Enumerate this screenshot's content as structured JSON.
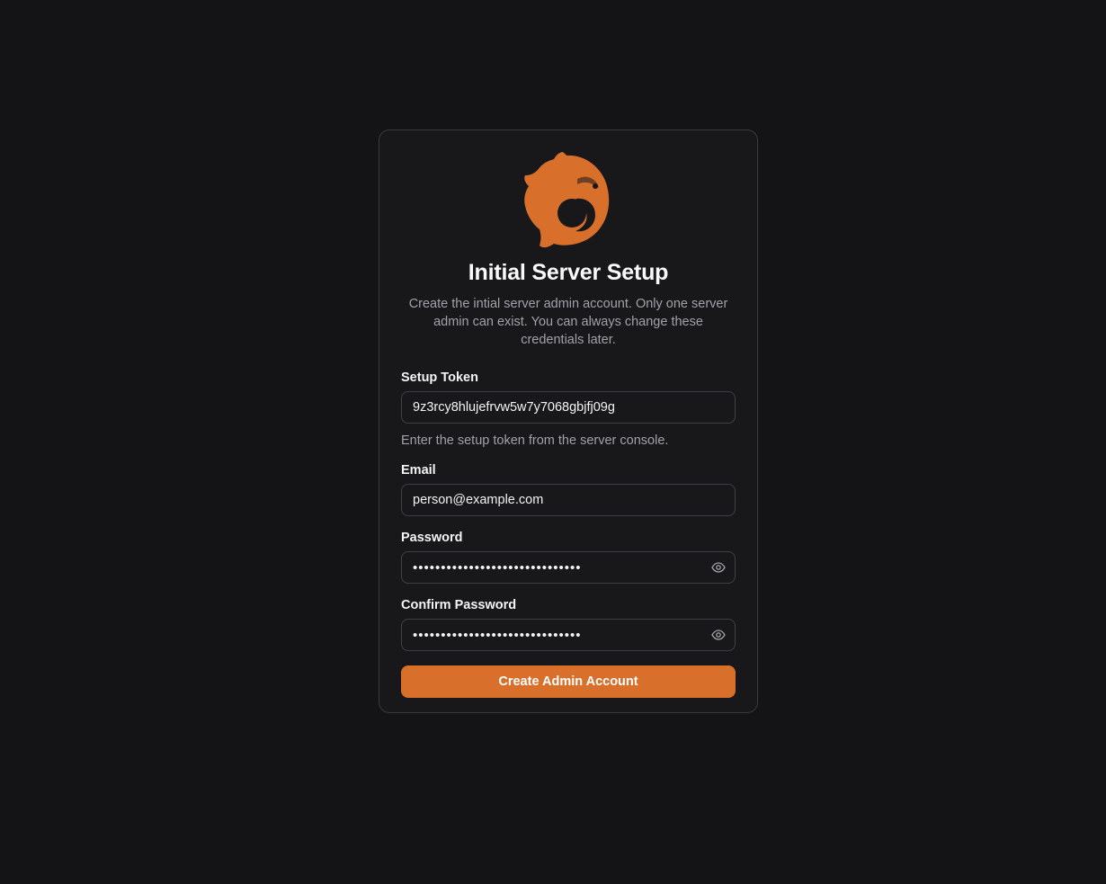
{
  "brand": {
    "logo_icon": "phoenix-logo-icon",
    "accent_color": "#d8702b"
  },
  "setup": {
    "title": "Initial Server Setup",
    "subtitle": "Create the intial server admin account. Only one server admin can exist. You can always change these credentials later."
  },
  "form": {
    "token": {
      "label": "Setup Token",
      "value": "9z3rcy8hlujefrvw5w7y7068gbjfj09g",
      "hint": "Enter the setup token from the server console."
    },
    "email": {
      "label": "Email",
      "value": "person@example.com"
    },
    "password": {
      "label": "Password",
      "value": "aaaaaaaaaaaaaaaaaaaaaaaaaaaaaa",
      "toggle_icon": "eye-icon"
    },
    "confirm_password": {
      "label": "Confirm Password",
      "value": "aaaaaaaaaaaaaaaaaaaaaaaaaaaaaa",
      "toggle_icon": "eye-icon"
    },
    "submit_label": "Create Admin Account"
  }
}
